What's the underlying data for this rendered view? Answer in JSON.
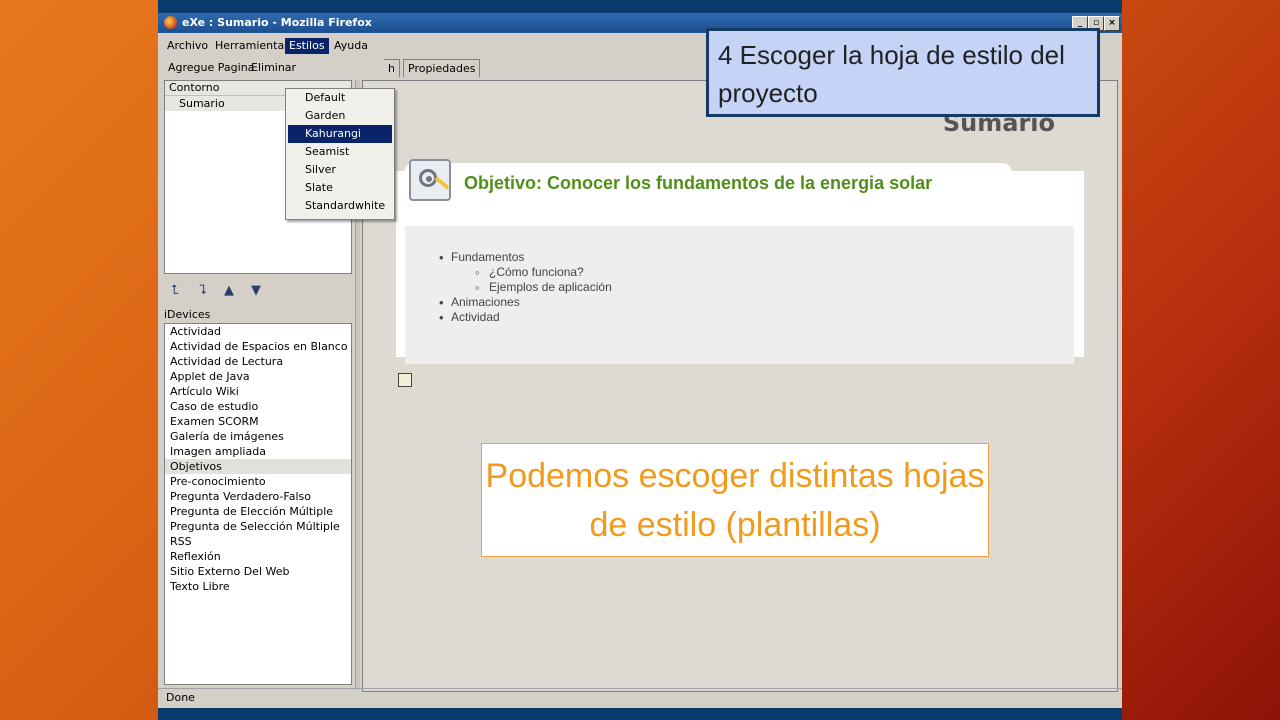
{
  "window": {
    "title": "eXe : Sumario - Mozilla Firefox"
  },
  "menubar": {
    "items": [
      "Archivo",
      "Herramientas",
      "Estilos",
      "Ayuda"
    ]
  },
  "toolbar": {
    "add_page": "Agregue Pagina",
    "delete": "Eliminar"
  },
  "tabs": [
    "h",
    "Propiedades"
  ],
  "outline": {
    "header": "Contorno",
    "items": [
      "Sumario"
    ]
  },
  "idevices": {
    "label": "iDevices",
    "items": [
      "Actividad",
      "Actividad de Espacios en Blanco",
      "Actividad de Lectura",
      "Applet de Java",
      "Artículo Wiki",
      "Caso de estudio",
      "Examen SCORM",
      "Galería de imágenes",
      "Imagen ampliada",
      "Objetivos",
      "Pre-conocimiento",
      "Pregunta Verdadero-Falso",
      "Pregunta de Elección Múltiple",
      "Pregunta de Selección Múltiple",
      "RSS",
      "Reflexión",
      "Sitio Externo Del Web",
      "Texto Libre"
    ],
    "selected": "Objetivos"
  },
  "styles_menu": {
    "options": [
      "Default",
      "Garden",
      "Kahurangi",
      "Seamist",
      "Silver",
      "Slate",
      "Standardwhite"
    ],
    "highlighted": "Kahurangi"
  },
  "content": {
    "heading": "Sumario",
    "idevice_title": "Objetivo: Conocer los fundamentos de la energia solar",
    "list": [
      {
        "text": "Fundamentos",
        "level": 1
      },
      {
        "text": "¿Cómo funciona?",
        "level": 2
      },
      {
        "text": "Ejemplos de aplicación",
        "level": 2
      },
      {
        "text": "Animaciones",
        "level": 1
      },
      {
        "text": "Actividad",
        "level": 1
      }
    ]
  },
  "status": "Done",
  "callouts": {
    "step": "4 Escoger la hoja de estilo del proyecto",
    "note": "Podemos escoger distintas hojas de estilo (plantillas)"
  },
  "colors": {
    "accent": "#0a246a",
    "idevice_title": "#4f8f1a",
    "callout_text": "#f09a1e"
  }
}
